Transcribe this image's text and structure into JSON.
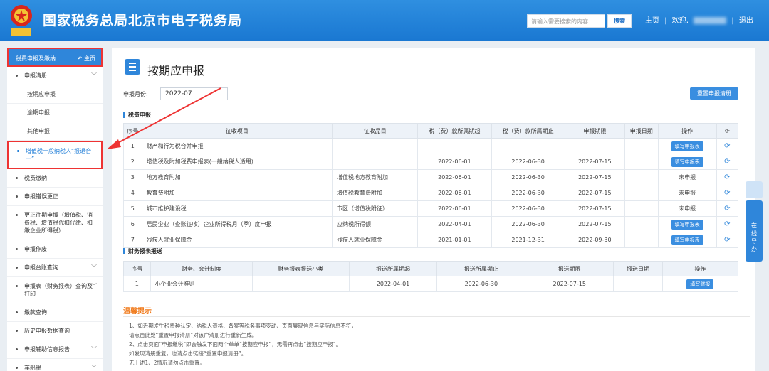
{
  "header": {
    "title": "国家税务总局北京市电子税务局",
    "search_placeholder": "请输入需要搜索的内容",
    "search_button": "搜索",
    "home_link": "主页",
    "separator": "|",
    "welcome": "欢迎,",
    "logout": "退出",
    "emblem_caption": "中国税务"
  },
  "sidebar": {
    "header_label": "税费申报及缴纳",
    "home_label": "主页",
    "items": [
      {
        "label": "申报清册",
        "expand": true
      },
      {
        "label": "按期应申报",
        "sub": true
      },
      {
        "label": "逾期申报",
        "sub": true
      },
      {
        "label": "其他申报",
        "sub": true
      },
      {
        "label": "增值税一般纳税人“报退合一”",
        "active": true
      },
      {
        "label": "税费缴纳"
      },
      {
        "label": "申报错误更正"
      },
      {
        "label": "更正往期申报（增值税、消费税、增值税代扣代缴、扣缴企业所得税）"
      },
      {
        "label": "申报作废"
      },
      {
        "label": "申报台账查询",
        "expand": true
      },
      {
        "label": "申报表（财务报表）查询及打印",
        "expand": true
      },
      {
        "label": "缴款查询"
      },
      {
        "label": "历史申报数据查询"
      },
      {
        "label": "申报辅助信息报告",
        "expand": true
      },
      {
        "label": "车船税",
        "expand": true
      }
    ]
  },
  "main": {
    "page_title": "按期应申报",
    "month_label": "申报月份:",
    "month_value": "2022-07",
    "reset_button": "重置申报清册",
    "tax_section": "税费申报",
    "tax_columns": [
      "序号",
      "征收项目",
      "征收品目",
      "税（费）款所属期起",
      "税（费）款所属期止",
      "申报期限",
      "申报日期",
      "操作"
    ],
    "tax_rows": [
      {
        "no": "1",
        "item": "财产和行为税合并申报",
        "sub": "",
        "start": "",
        "end": "",
        "deadline": "",
        "date": "",
        "op": "填写申报表",
        "op_btn": true
      },
      {
        "no": "2",
        "item": "增值税及附加税费申报表(一般纳税人适用)",
        "sub": "",
        "start": "2022-06-01",
        "end": "2022-06-30",
        "deadline": "2022-07-15",
        "date": "",
        "op": "填写申报表",
        "op_btn": true
      },
      {
        "no": "3",
        "item": "地方教育附加",
        "sub": "增值税地方教育附加",
        "start": "2022-06-01",
        "end": "2022-06-30",
        "deadline": "2022-07-15",
        "date": "",
        "op": "未申报",
        "op_btn": false
      },
      {
        "no": "4",
        "item": "教育费附加",
        "sub": "增值税教育费附加",
        "start": "2022-06-01",
        "end": "2022-06-30",
        "deadline": "2022-07-15",
        "date": "",
        "op": "未申报",
        "op_btn": false
      },
      {
        "no": "5",
        "item": "城市维护建设税",
        "sub": "市区（增值税附征）",
        "start": "2022-06-01",
        "end": "2022-06-30",
        "deadline": "2022-07-15",
        "date": "",
        "op": "未申报",
        "op_btn": false
      },
      {
        "no": "6",
        "item": "居民企业（查账征收）企业所得税月（季）度申报",
        "sub": "应纳税所得额",
        "start": "2022-04-01",
        "end": "2022-06-30",
        "deadline": "2022-07-15",
        "date": "",
        "op": "填写申报表",
        "op_btn": true
      },
      {
        "no": "7",
        "item": "残疾人就业保障金",
        "sub": "残疾人就业保障金",
        "start": "2021-01-01",
        "end": "2021-12-31",
        "deadline": "2022-09-30",
        "date": "",
        "op": "填写申报表",
        "op_btn": true
      }
    ],
    "fin_section": "财务报表报送",
    "fin_columns": [
      "序号",
      "财务、会计制度",
      "财务报表报送小类",
      "报送所属期起",
      "报送所属期止",
      "报送期限",
      "报送日期",
      "操作"
    ],
    "fin_rows": [
      {
        "no": "1",
        "system": "小企业会计准则",
        "sub": "",
        "start": "2022-04-01",
        "end": "2022-06-30",
        "deadline": "2022-07-15",
        "date": "",
        "op": "填写财报"
      }
    ],
    "tips_title": "温馨提示",
    "tips": [
      "1、如近期发生税费种认定、纳税人资格、备案等税务事项变动、页面展现信息与实际信息不符，",
      "请点击此处“重置申报清册”对该户清册进行重新生成。",
      "2、点击页面“申报缴税”即会触发下面两个单单“按期应申报”，无需再点击“按期应申报”。",
      "如发现清册重复，也请点击链接“重置申报清册”。",
      "无上述1、2情况请勿点击重置。"
    ]
  },
  "float": {
    "label": "在线导办"
  },
  "colors": {
    "header_blue": "#1a78d2",
    "accent_blue": "#2f86da",
    "highlight_red": "#e33333",
    "tips_orange": "#f07b1d"
  }
}
